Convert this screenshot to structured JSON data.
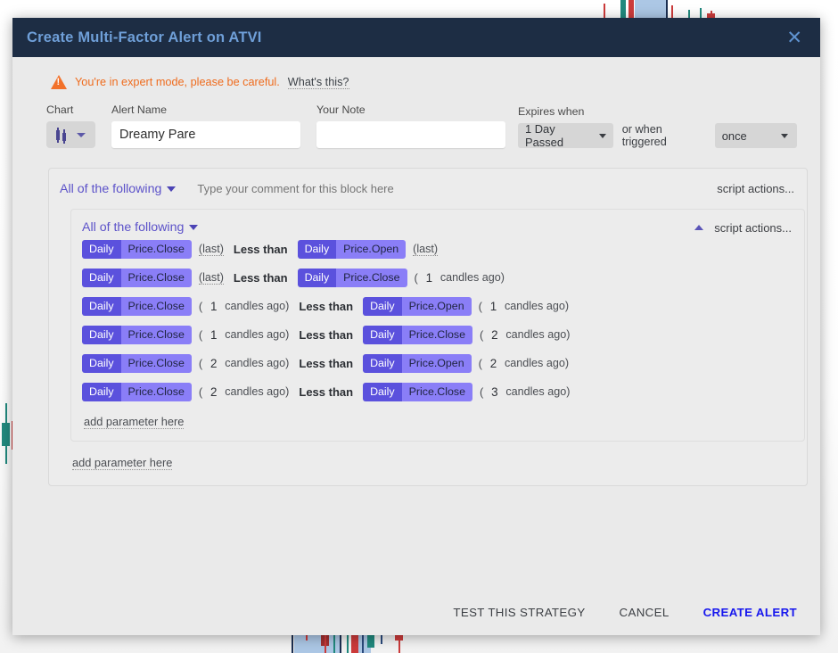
{
  "window": {
    "title": "Create Multi-Factor Alert on ATVI",
    "close_icon": "close-icon"
  },
  "warning": {
    "icon": "warning-triangle-icon",
    "message": "You're in expert mode, please be careful.",
    "help_link": "What's this?"
  },
  "form": {
    "chart": {
      "label": "Chart",
      "icon": "candlestick-icon",
      "caret": "chevron-down-icon"
    },
    "alert_name": {
      "label": "Alert Name",
      "value": "Dreamy Pare",
      "placeholder": ""
    },
    "note": {
      "label": "Your Note",
      "value": "",
      "placeholder": ""
    },
    "expires": {
      "label": "Expires when",
      "duration_value": "1 Day Passed",
      "middle_text": "or when triggered",
      "trigger_value": "once"
    }
  },
  "outer_block": {
    "logic": "All of the following",
    "comment_placeholder": "Type your comment for this block here",
    "script_actions": "script actions...",
    "add_parameter": "add parameter here"
  },
  "inner_block": {
    "logic": "All of the following",
    "script_actions": "script actions...",
    "add_parameter": "add parameter here",
    "collapse_icon": "chevron-up-icon",
    "rows": [
      {
        "left": {
          "timeframe": "Daily",
          "field": "Price.Close",
          "offset_kind": "last",
          "offset_text": "(last)"
        },
        "operator": "Less than",
        "right": {
          "timeframe": "Daily",
          "field": "Price.Open",
          "offset_kind": "last",
          "offset_text": "(last)"
        }
      },
      {
        "left": {
          "timeframe": "Daily",
          "field": "Price.Close",
          "offset_kind": "last",
          "offset_text": "(last)"
        },
        "operator": "Less than",
        "right": {
          "timeframe": "Daily",
          "field": "Price.Close",
          "offset_kind": "candles",
          "candles": "1",
          "candles_label": "candles ago)"
        }
      },
      {
        "left": {
          "timeframe": "Daily",
          "field": "Price.Close",
          "offset_kind": "candles",
          "candles": "1",
          "candles_label": "candles ago)"
        },
        "operator": "Less than",
        "right": {
          "timeframe": "Daily",
          "field": "Price.Open",
          "offset_kind": "candles",
          "candles": "1",
          "candles_label": "candles ago)"
        }
      },
      {
        "left": {
          "timeframe": "Daily",
          "field": "Price.Close",
          "offset_kind": "candles",
          "candles": "1",
          "candles_label": "candles ago)"
        },
        "operator": "Less than",
        "right": {
          "timeframe": "Daily",
          "field": "Price.Close",
          "offset_kind": "candles",
          "candles": "2",
          "candles_label": "candles ago)"
        }
      },
      {
        "left": {
          "timeframe": "Daily",
          "field": "Price.Close",
          "offset_kind": "candles",
          "candles": "2",
          "candles_label": "candles ago)"
        },
        "operator": "Less than",
        "right": {
          "timeframe": "Daily",
          "field": "Price.Open",
          "offset_kind": "candles",
          "candles": "2",
          "candles_label": "candles ago)"
        }
      },
      {
        "left": {
          "timeframe": "Daily",
          "field": "Price.Close",
          "offset_kind": "candles",
          "candles": "2",
          "candles_label": "candles ago)"
        },
        "operator": "Less than",
        "right": {
          "timeframe": "Daily",
          "field": "Price.Close",
          "offset_kind": "candles",
          "candles": "3",
          "candles_label": "candles ago)"
        }
      }
    ]
  },
  "footer": {
    "test": "TEST THIS STRATEGY",
    "cancel": "CANCEL",
    "create": "CREATE ALERT"
  },
  "colors": {
    "titlebar_bg": "#1d2d44",
    "title_text": "#6f9fd8",
    "accent_purple": "#5b51dd",
    "accent_purple_light": "#8a7ef7",
    "warning_orange": "#ef6c1e",
    "primary_action": "#1717ee",
    "candle_up": "#21897e",
    "candle_down": "#cc3b3b"
  }
}
